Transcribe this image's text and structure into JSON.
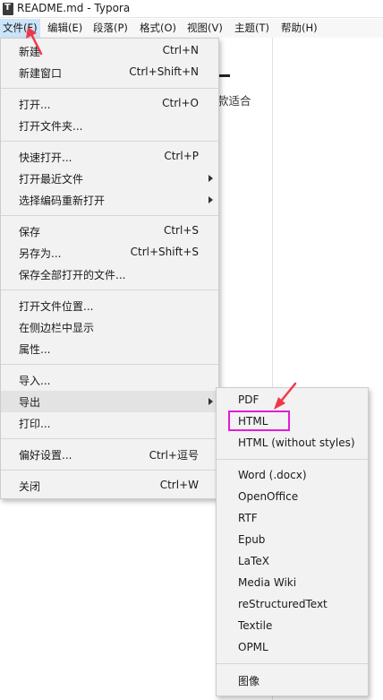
{
  "window": {
    "icon_letter": "T",
    "title": "README.md - Typora"
  },
  "menubar": {
    "items": [
      {
        "label": "文件(F)"
      },
      {
        "label": "编辑(E)"
      },
      {
        "label": "段落(P)"
      },
      {
        "label": "格式(O)"
      },
      {
        "label": "视图(V)"
      },
      {
        "label": "主题(T)"
      },
      {
        "label": "帮助(H)"
      }
    ]
  },
  "editor": {
    "visible_text": "款适合"
  },
  "file_menu": {
    "items": [
      {
        "label": "新建",
        "shortcut": "Ctrl+N"
      },
      {
        "label": "新建窗口",
        "shortcut": "Ctrl+Shift+N"
      },
      {
        "label": "打开...",
        "shortcut": "Ctrl+O"
      },
      {
        "label": "打开文件夹...",
        "shortcut": ""
      },
      {
        "label": "快速打开...",
        "shortcut": "Ctrl+P"
      },
      {
        "label": "打开最近文件",
        "shortcut": "",
        "submenu": true
      },
      {
        "label": "选择编码重新打开",
        "shortcut": "",
        "submenu": true
      },
      {
        "label": "保存",
        "shortcut": "Ctrl+S"
      },
      {
        "label": "另存为...",
        "shortcut": "Ctrl+Shift+S"
      },
      {
        "label": "保存全部打开的文件...",
        "shortcut": ""
      },
      {
        "label": "打开文件位置...",
        "shortcut": ""
      },
      {
        "label": "在侧边栏中显示",
        "shortcut": ""
      },
      {
        "label": "属性...",
        "shortcut": ""
      },
      {
        "label": "导入...",
        "shortcut": ""
      },
      {
        "label": "导出",
        "shortcut": "",
        "submenu": true,
        "highlighted": true
      },
      {
        "label": "打印...",
        "shortcut": ""
      },
      {
        "label": "偏好设置...",
        "shortcut": "Ctrl+逗号"
      },
      {
        "label": "关闭",
        "shortcut": "Ctrl+W"
      }
    ]
  },
  "export_submenu": {
    "items": [
      {
        "label": "PDF"
      },
      {
        "label": "HTML",
        "annotated": true
      },
      {
        "label": "HTML (without styles)"
      },
      {
        "label": "Word (.docx)"
      },
      {
        "label": "OpenOffice"
      },
      {
        "label": "RTF"
      },
      {
        "label": "Epub"
      },
      {
        "label": "LaTeX"
      },
      {
        "label": "Media Wiki"
      },
      {
        "label": "reStructuredText"
      },
      {
        "label": "Textile"
      },
      {
        "label": "OPML"
      },
      {
        "label": "图像"
      }
    ]
  },
  "annotations": {
    "highlight_color": "#e21cd6",
    "arrow_color": "#f0384b"
  }
}
